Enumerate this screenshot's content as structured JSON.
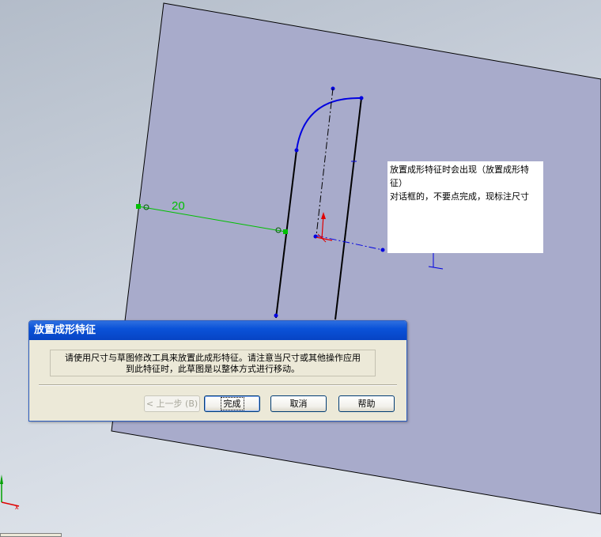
{
  "dimension": {
    "value": "20"
  },
  "annotation": {
    "line1": "放置成形特征时会出现（放置成形特征）",
    "line2": "对话框的，不要点完成，现标注尺寸"
  },
  "dialog": {
    "title": "放置成形特征",
    "message_line1": "请使用尺寸与草图修改工具来放置此成形特征。请注意当尺寸或其他操作应用",
    "message_line2": "到此特征时，此草图是以整体方式进行移动。",
    "buttons": {
      "back": "< 上一步 (B)",
      "finish": "完成",
      "cancel": "取消",
      "help": "帮助"
    }
  },
  "triad": {
    "x_label": "x"
  },
  "colors": {
    "plane": "#a8abcb",
    "arc": "#0000e0",
    "dimension": "#00c000",
    "dialog_title": "#0a52d8",
    "dialog_bg": "#ece9d8"
  }
}
